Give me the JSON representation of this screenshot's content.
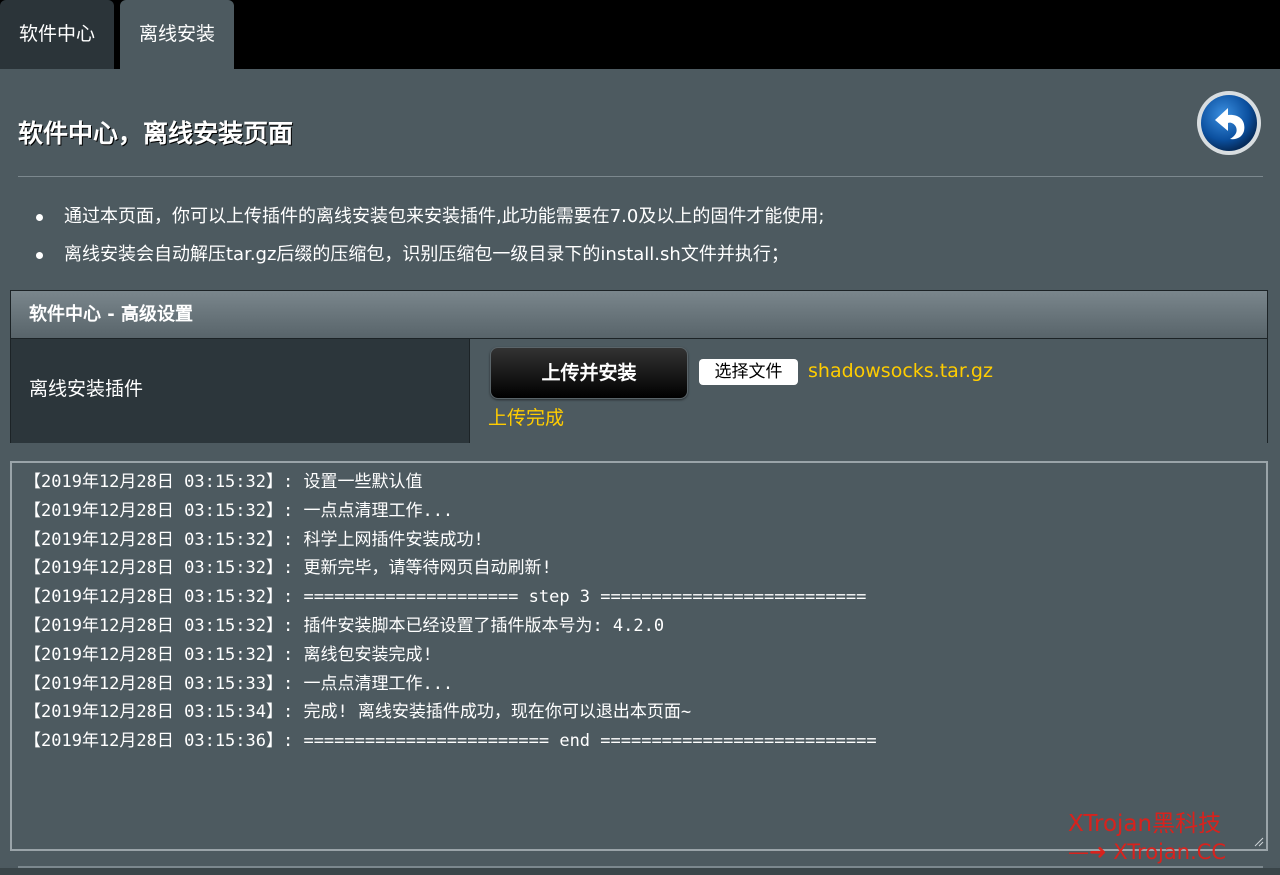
{
  "tabs": [
    {
      "label": "软件中心"
    },
    {
      "label": "离线安装"
    }
  ],
  "page": {
    "title": "软件中心，离线安装页面",
    "back_icon": "back-arrow-icon"
  },
  "notes": [
    "通过本页面，你可以上传插件的离线安装包来安装插件,此功能需要在7.0及以上的固件才能使用;",
    "离线安装会自动解压tar.gz后缀的压缩包，识别压缩包一级目录下的install.sh文件并执行；"
  ],
  "settings": {
    "header": "软件中心 - 高级设置",
    "row_label": "离线安装插件",
    "upload_button": "上传并安装",
    "choose_file_button": "选择文件",
    "file_name": "shadowsocks.tar.gz",
    "status": "上传完成"
  },
  "log": [
    "【2019年12月28日 03:15:32】: 设置一些默认值",
    "【2019年12月28日 03:15:32】: 一点点清理工作...",
    "【2019年12月28日 03:15:32】: 科学上网插件安装成功!",
    "【2019年12月28日 03:15:32】: 更新完毕，请等待网页自动刷新!",
    "【2019年12月28日 03:15:32】: ===================== step 3 ==========================",
    "【2019年12月28日 03:15:32】: 插件安装脚本已经设置了插件版本号为: 4.2.0",
    "【2019年12月28日 03:15:32】: 离线包安装完成!",
    "【2019年12月28日 03:15:33】: 一点点清理工作...",
    "【2019年12月28日 03:15:34】: 完成! 离线安装插件成功，现在你可以退出本页面~",
    "【2019年12月28日 03:15:36】: ======================== end ==========================="
  ],
  "watermark": {
    "line1": "XTrojan黑科技",
    "line2": "—➜ XTrojan.CC"
  },
  "colors": {
    "accent_yellow": "#ffcc00",
    "background": "#4d5a60",
    "watermark_red": "#e0201a"
  }
}
